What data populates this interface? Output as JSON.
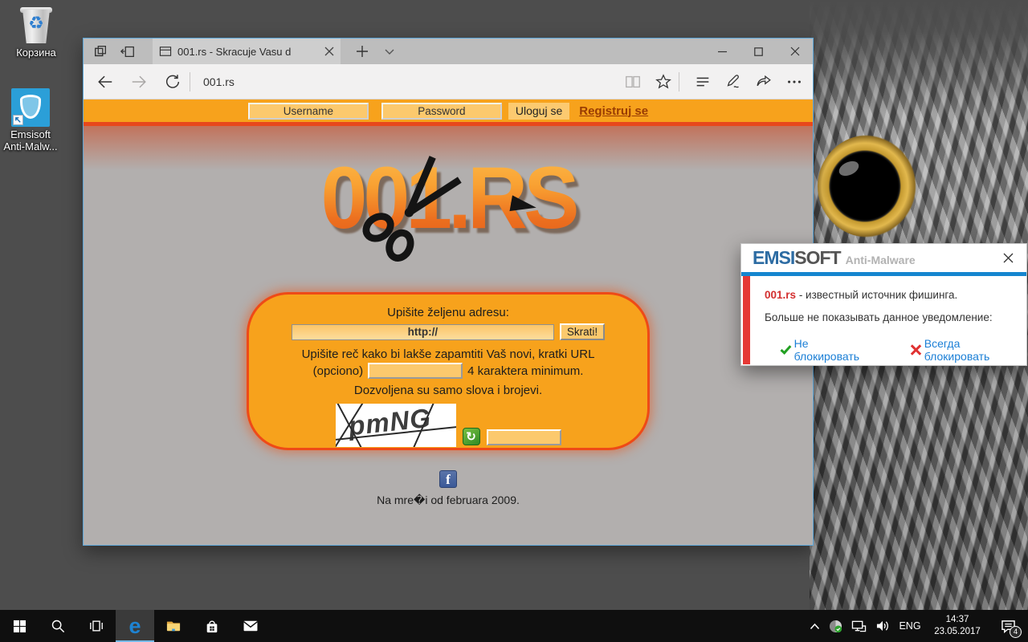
{
  "colors": {
    "accent_orange": "#F7A21C",
    "stripe_red": "#E8481C",
    "page_gray": "#B2AFAE",
    "emsisoft_blue": "#1586CF",
    "alert_red": "#E53935",
    "link_blue": "#1B7FD6",
    "taskbar_black": "#0F0F0F",
    "window_border_blue": "#5CA6D8"
  },
  "desktop": {
    "icons": [
      {
        "name": "recycle-bin",
        "label": "Корзина"
      },
      {
        "name": "emsisoft-shortcut",
        "label_line1": "Emsisoft",
        "label_line2": "Anti-Malw..."
      }
    ]
  },
  "browser": {
    "tab_title": "001.rs - Skracuje Vasu d",
    "address": "001.rs",
    "page": {
      "header": {
        "username_value": "Username",
        "password_value": "Password",
        "login_button": "Uloguj se",
        "register_link": "Registruj se"
      },
      "logo_text": "001.RS",
      "form": {
        "address_label": "Upišite željenu adresu:",
        "url_value": "http://",
        "shorten_button": "Skrati!",
        "hint_line": "Upišite reč kako bi lakše zapamtiti Vaš novi, kratki URL",
        "optional_label": "(opciono)",
        "min_note": "4 karaktera minimum.",
        "allowed_note": "Dozvoljena su samo slova i brojevi.",
        "captcha_text": "pmNG"
      },
      "footer": {
        "facebook_glyph": "f",
        "online_since": "Na mre�i od februara 2009."
      }
    }
  },
  "popup": {
    "brand_part1": "EMSI",
    "brand_part2": "SOFT",
    "brand_suffix": "Anti-Malware",
    "site": "001.rs",
    "message_rest": "- известный источник фишинга.",
    "dont_show_line": "Больше не показывать данное уведомление:",
    "allow_link": "Не блокировать",
    "block_link": "Всегда блокировать"
  },
  "taskbar": {
    "language": "ENG",
    "time": "14:37",
    "date": "23.05.2017",
    "notification_count": "4",
    "edge_glyph": "e"
  },
  "glyphs": {
    "captcha_refresh": "↻",
    "recycle_symbol": "♻"
  }
}
